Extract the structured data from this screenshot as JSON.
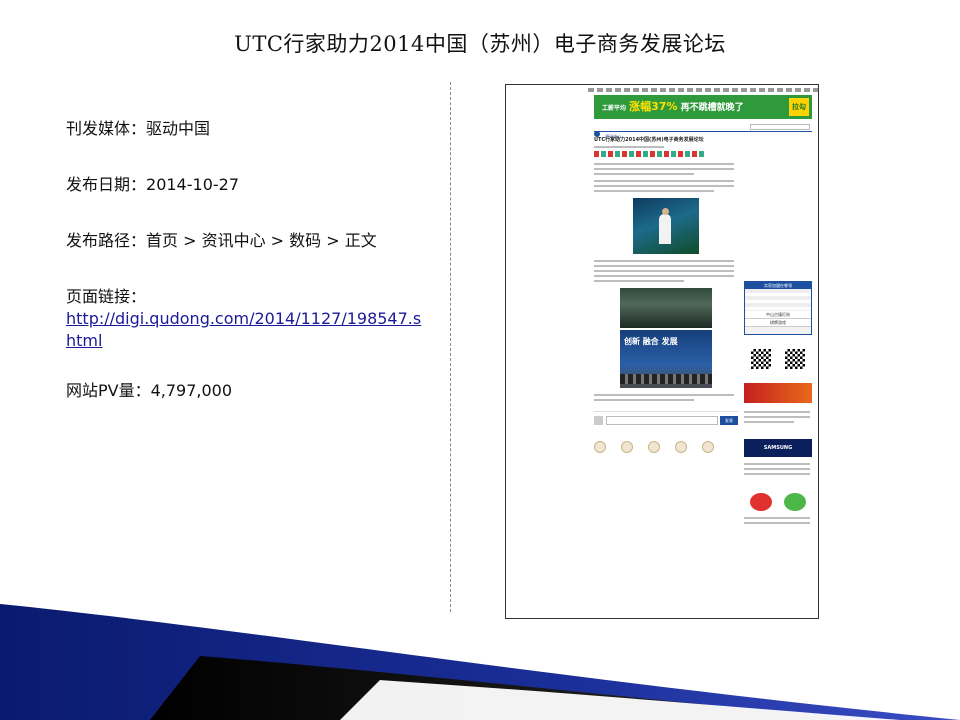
{
  "title": "UTC行家助力2014中国（苏州）电子商务发展论坛",
  "fields": [
    {
      "label": "刊发媒体：",
      "value": "驱动中国"
    },
    {
      "label": "发布日期：",
      "value": "2014-10-27"
    },
    {
      "label": "发布路径：",
      "value": "首页 > 资讯中心 > 数码 > 正文"
    },
    {
      "label": "页面链接：",
      "value": "http://digi.qudong.com/2014/1127/198547.shtml"
    },
    {
      "label": "网站PV量：",
      "value": "4,797,000"
    }
  ],
  "screenshot": {
    "banner_text": "工薪平均",
    "banner_highlight": "涨幅37%",
    "banner_tail": "再不跳槽就晚了",
    "banner_logo": "拉勾",
    "site_name": "资讯中心",
    "article_title": "UTC行家助力2014中国(苏州)电子商务发展论坛",
    "photo_banner_line1": "创新  融合  发展",
    "sidebar_box_title": "实家加盟在哪领",
    "sidebar_link1": "中山古镇灯饰",
    "sidebar_link2": "棋牌游戏",
    "samsung_logo": "SAMSUNG",
    "comment_button": "发表",
    "colors": {
      "banner": "#2e9a3c",
      "banner_highlight": "#ffe000",
      "accent": "#1c4fa0"
    }
  }
}
